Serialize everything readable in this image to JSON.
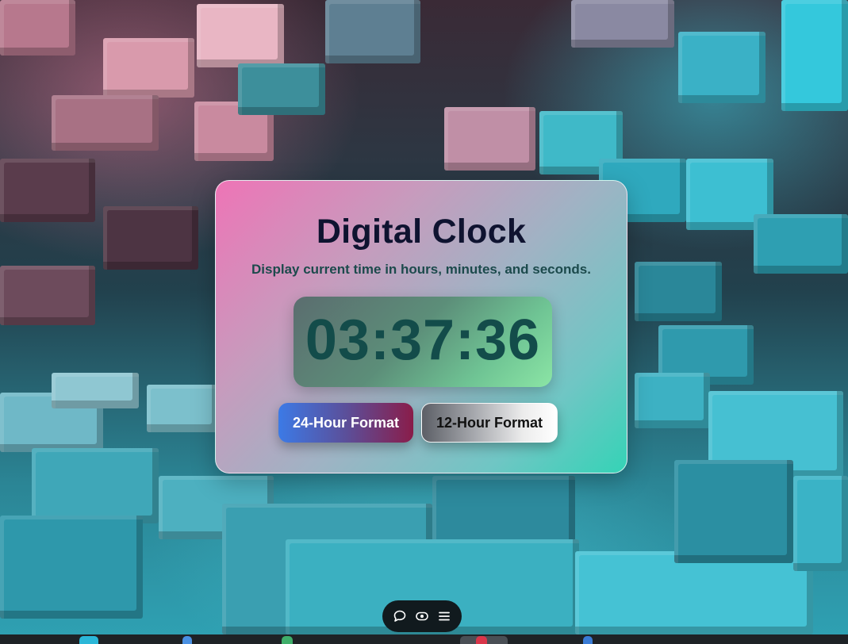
{
  "clock_card": {
    "title": "Digital Clock",
    "subtitle": "Display current time in hours, minutes, and seconds.",
    "time": "03:37:36",
    "buttons": {
      "format_24": "24-Hour Format",
      "format_12": "12-Hour Format"
    }
  },
  "toolbar": {
    "icons": [
      "comment-icon",
      "eye-icon",
      "menu-icon"
    ]
  },
  "colors": {
    "title": "#0f1330",
    "subtitle": "#1c4a4c",
    "time": "#134c4a",
    "card_gradient_start": "#ee74b6",
    "card_gradient_end": "#34d3b6"
  }
}
